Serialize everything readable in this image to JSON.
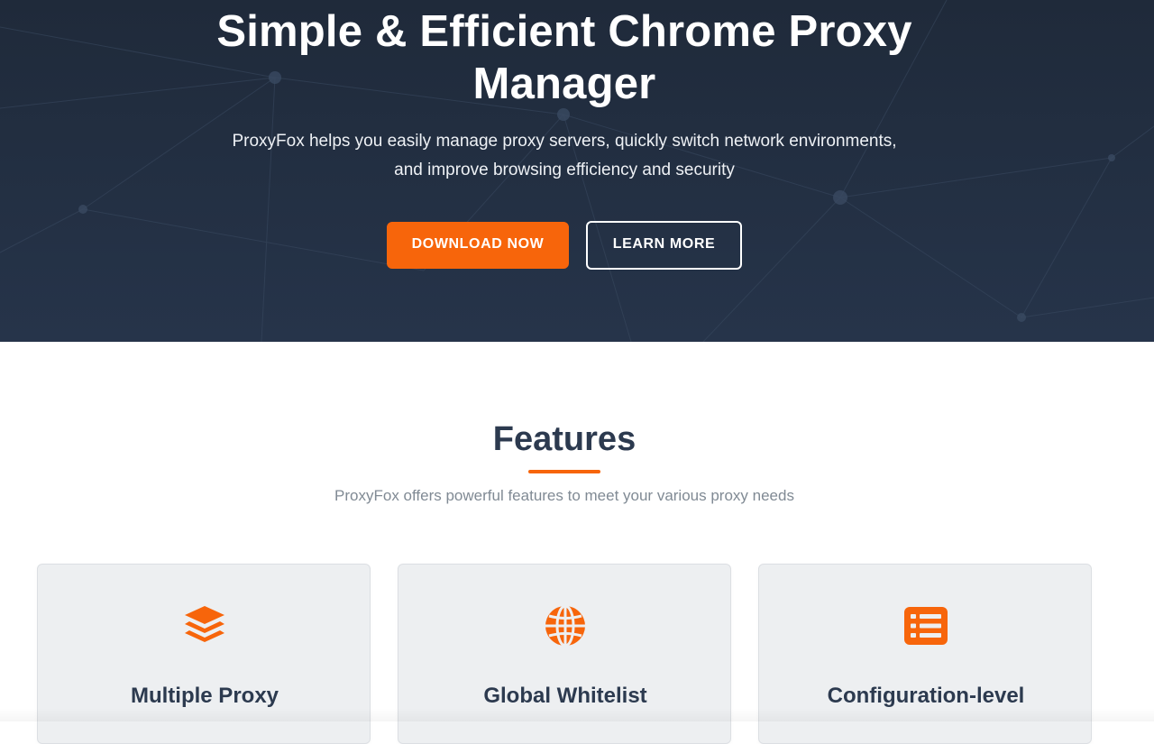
{
  "hero": {
    "title_line1": "Simple & Efficient Chrome Proxy",
    "title_line2": "Manager",
    "subtitle_line1": "ProxyFox helps you easily manage proxy servers, quickly switch network environments,",
    "subtitle_line2": "and improve browsing efficiency and security",
    "download_button": "DOWNLOAD NOW",
    "learn_more_button": "LEARN MORE"
  },
  "features": {
    "title": "Features",
    "subtitle": "ProxyFox offers powerful features to meet your various proxy needs",
    "cards": [
      {
        "icon": "layers-icon",
        "title": "Multiple Proxy"
      },
      {
        "icon": "globe-icon",
        "title": "Global Whitelist"
      },
      {
        "icon": "list-icon",
        "title": "Configuration-level"
      }
    ]
  },
  "colors": {
    "hero_background": "#1f2a3a",
    "accent": "#f7650b",
    "heading": "#2c3a4f",
    "muted_text": "#808a94",
    "card_background": "#edeff1"
  }
}
